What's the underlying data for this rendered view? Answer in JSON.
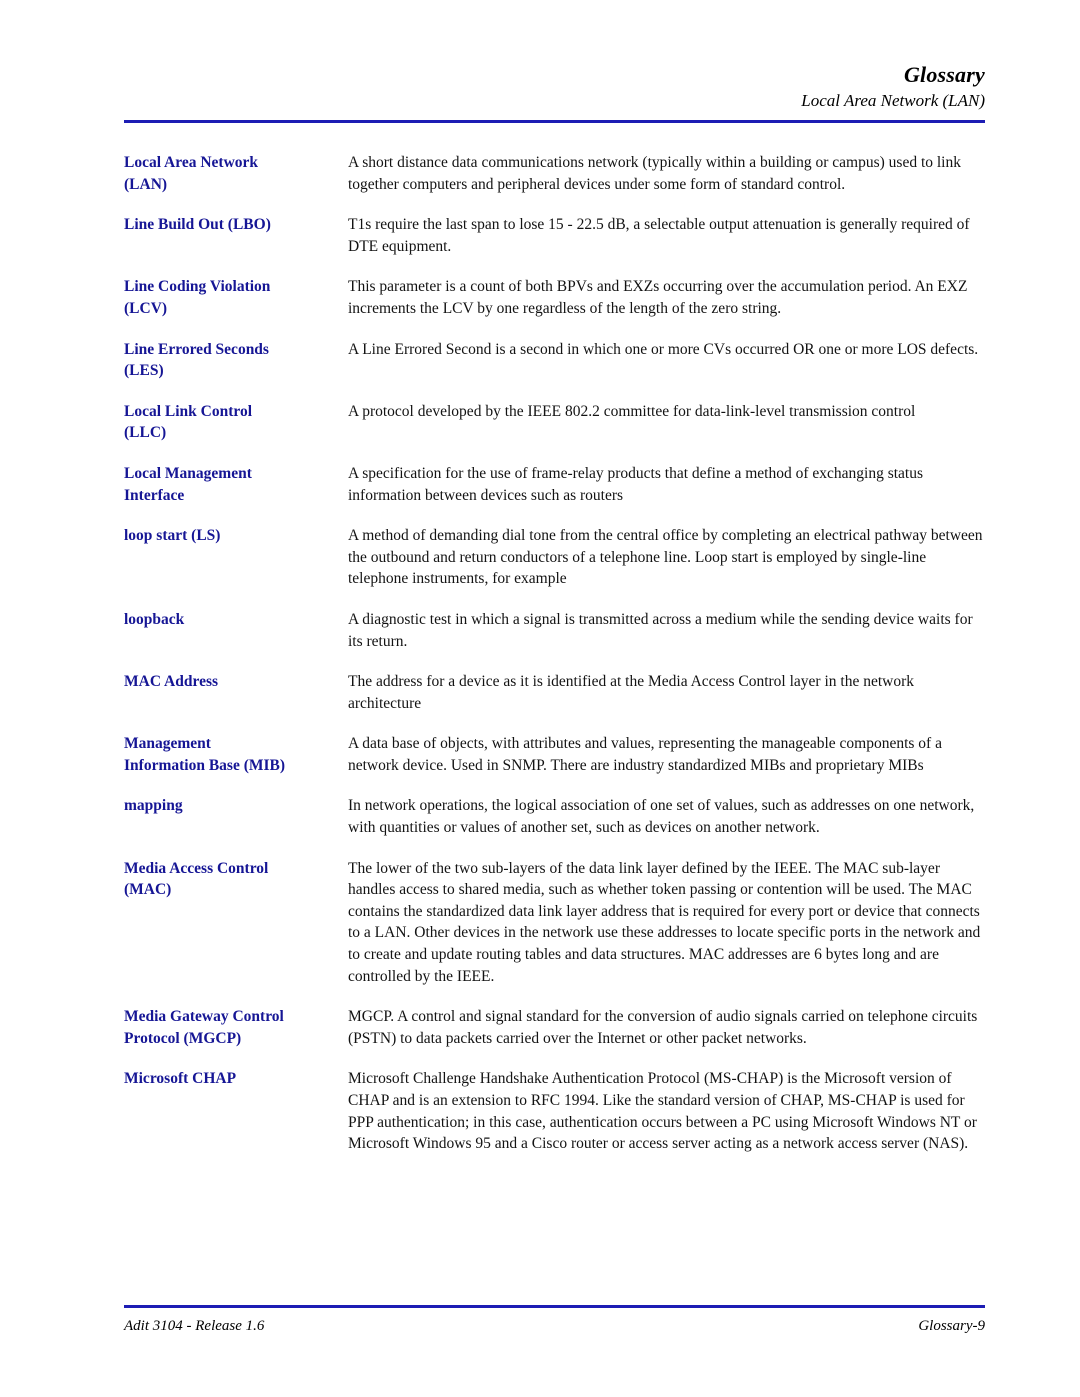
{
  "header": {
    "title": "Glossary",
    "subtitle": "Local Area Network (LAN)"
  },
  "colors": {
    "rule": "#1d1db4",
    "term": "#161695",
    "body_text": "#131313"
  },
  "entries": [
    {
      "term": "Local Area Network\n(LAN)",
      "definition": "A short distance data communications network (typically within a building or campus) used to link together computers and peripheral devices under some form of standard control."
    },
    {
      "term": "Line Build Out (LBO)",
      "definition": "T1s require the last span to lose 15 - 22.5 dB, a selectable output attenuation is generally required of DTE equipment."
    },
    {
      "term": "Line Coding Violation\n(LCV)",
      "definition": "This parameter is a count of both BPVs and EXZs occurring over the accumulation period. An EXZ increments the LCV by one regardless of the length of the zero string."
    },
    {
      "term": "Line Errored Seconds\n(LES)",
      "definition": "A Line Errored Second is a second in which one or more CVs occurred OR one or more LOS defects."
    },
    {
      "term": "Local Link Control\n(LLC)",
      "definition": "A protocol developed by the IEEE 802.2 committee for data-link-level transmission control"
    },
    {
      "term": "Local Management\nInterface",
      "definition": "A specification for the use of frame-relay products that define a method of exchanging status information between devices such as routers"
    },
    {
      "term": "loop start (LS)",
      "definition": "A method of demanding dial tone from the central office by completing an electrical pathway between the outbound and return conductors of a telephone line. Loop start is employed by single-line telephone instruments, for example"
    },
    {
      "term": "loopback",
      "definition": "A diagnostic test in which a signal is transmitted across a medium while the sending device waits for its return."
    },
    {
      "term": "MAC Address",
      "definition": "The address for a device as it is identified at the Media Access Control layer in the network architecture"
    },
    {
      "term": "Management\nInformation Base (MIB)",
      "definition": "A data base of objects, with attributes and values, representing the manageable components of a network device. Used in SNMP. There are industry standardized MIBs and proprietary MIBs"
    },
    {
      "term": "mapping",
      "definition": "In network operations, the logical association of one set of values, such as addresses on one network, with quantities or values of another set, such as devices on another network."
    },
    {
      "term": "Media Access Control\n(MAC)",
      "definition": "The lower of the two sub-layers of the data link layer defined by the IEEE. The MAC sub-layer handles access to shared media, such as whether token passing or contention will be used. The MAC contains the standardized data link layer address that is required for every port or device that connects to a LAN. Other devices in the network use these addresses to locate specific ports in the network and to create and update routing tables and data structures. MAC addresses are 6 bytes long and are controlled by the IEEE."
    },
    {
      "term": "Media Gateway Control\nProtocol (MGCP)",
      "definition": "MGCP. A control and signal standard for the conversion of audio signals carried on telephone circuits (PSTN) to data packets carried over the Internet or other packet networks."
    },
    {
      "term": "Microsoft CHAP",
      "definition": "Microsoft Challenge Handshake Authentication Protocol (MS-CHAP) is the Microsoft version of CHAP and is an extension to RFC 1994. Like the standard version of CHAP, MS-CHAP is used for PPP authentication; in this case, authentication occurs between a PC using Microsoft Windows NT or Microsoft Windows 95 and a Cisco router or access server acting as a network access server (NAS)."
    }
  ],
  "footer": {
    "left": "Adit 3104 - Release 1.6",
    "right": "Glossary-9"
  }
}
